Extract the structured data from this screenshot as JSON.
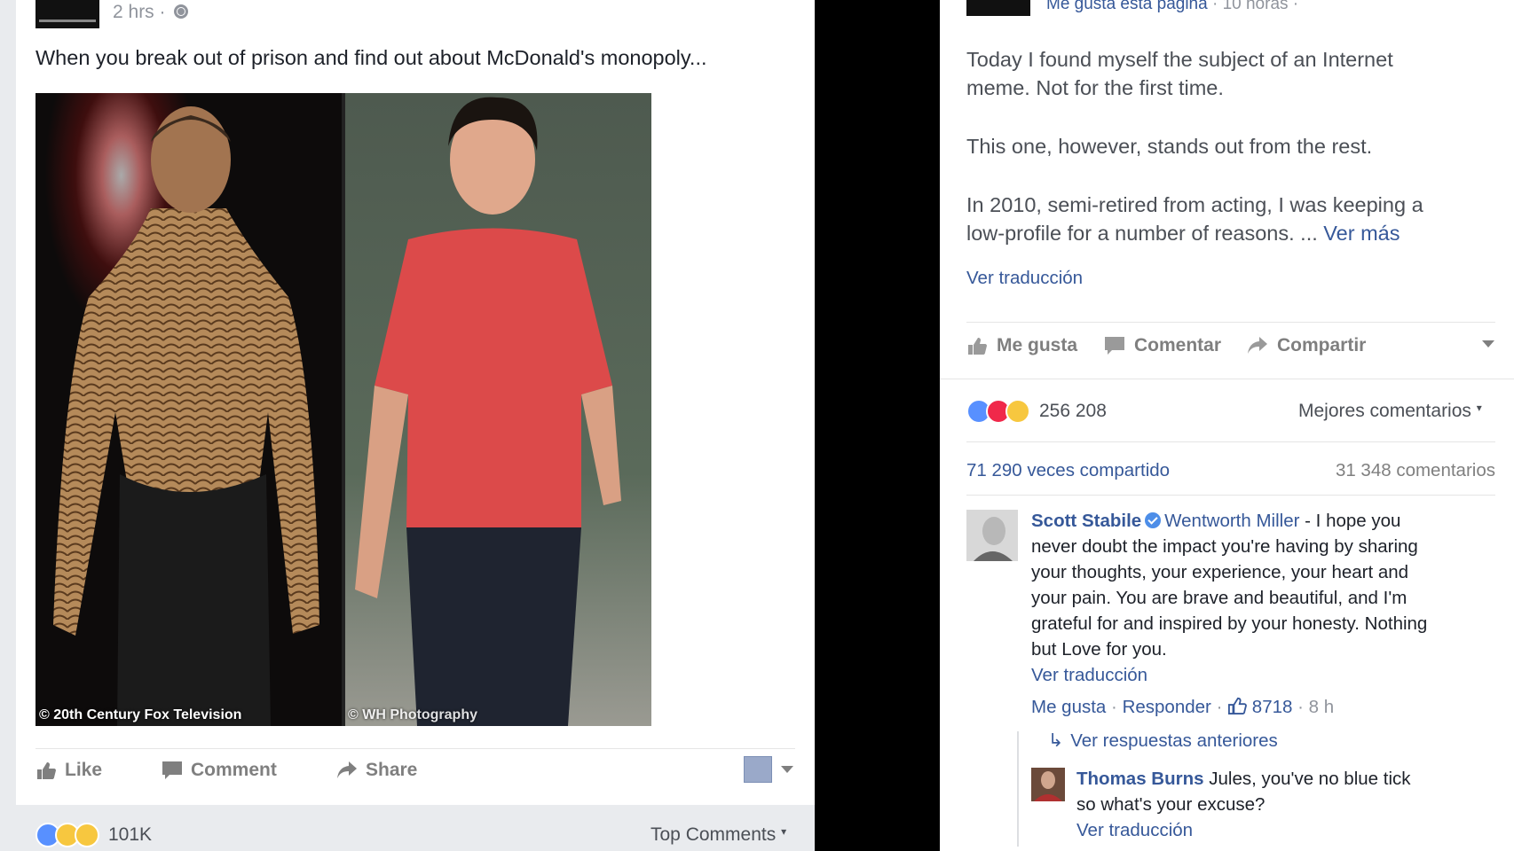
{
  "left_post": {
    "meta_time": "2 hrs ·",
    "text": "When you break out of prison and find out about McDonald's monopoly...",
    "photo_credits": [
      "© 20th Century Fox Television",
      "© WH Photography"
    ],
    "actions": [
      "Like",
      "Comment",
      "Share"
    ],
    "reaction_count": "101K",
    "sort_label": "Top Comments"
  },
  "right_post": {
    "meta_like_page": "Me gusta esta página",
    "meta_time": "· 10 horas ·",
    "paragraphs": [
      "Today I found myself the subject of an Internet",
      "meme. Not for the first time.",
      "This one, however, stands out from the rest.",
      "In 2010, semi-retired from acting, I was keeping a",
      "low-profile for a number of reasons. ..."
    ],
    "see_more": "Ver más",
    "translate": "Ver traducción",
    "actions": [
      "Me gusta",
      "Comentar",
      "Compartir"
    ],
    "reaction_count": "256 208",
    "sort_label": "Mejores comentarios",
    "shares": "71 290 veces compartido",
    "comments_count": "31 348 comentarios"
  },
  "comment_1": {
    "author": "Scott Stabile",
    "mention": "Wentworth Miller",
    "lines": [
      "- I hope you",
      "never doubt the impact you're having by sharing",
      "your thoughts, your experience, your heart and",
      "your pain. You are brave and beautiful, and I'm",
      "grateful for and inspired by your honesty. Nothing",
      "but Love for you."
    ],
    "translate": "Ver traducción",
    "like": "Me gusta",
    "reply": "Responder",
    "likes": "8718",
    "time": "· 8 h"
  },
  "previous_replies": "Ver respuestas anteriores",
  "comment_2": {
    "author": "Thomas Burns",
    "lines": [
      "Jules, you've no blue tick",
      "so what's your excuse?"
    ],
    "translate": "Ver traducción"
  },
  "colors": {
    "link": "#365899",
    "muted": "#90949c",
    "like_blue": "#5890ff",
    "love_red": "#f0284a"
  },
  "icons": [
    "globe-icon",
    "like-icon",
    "comment-icon",
    "share-icon",
    "verified-icon",
    "reply-arrow-icon",
    "chevron-down-icon"
  ]
}
